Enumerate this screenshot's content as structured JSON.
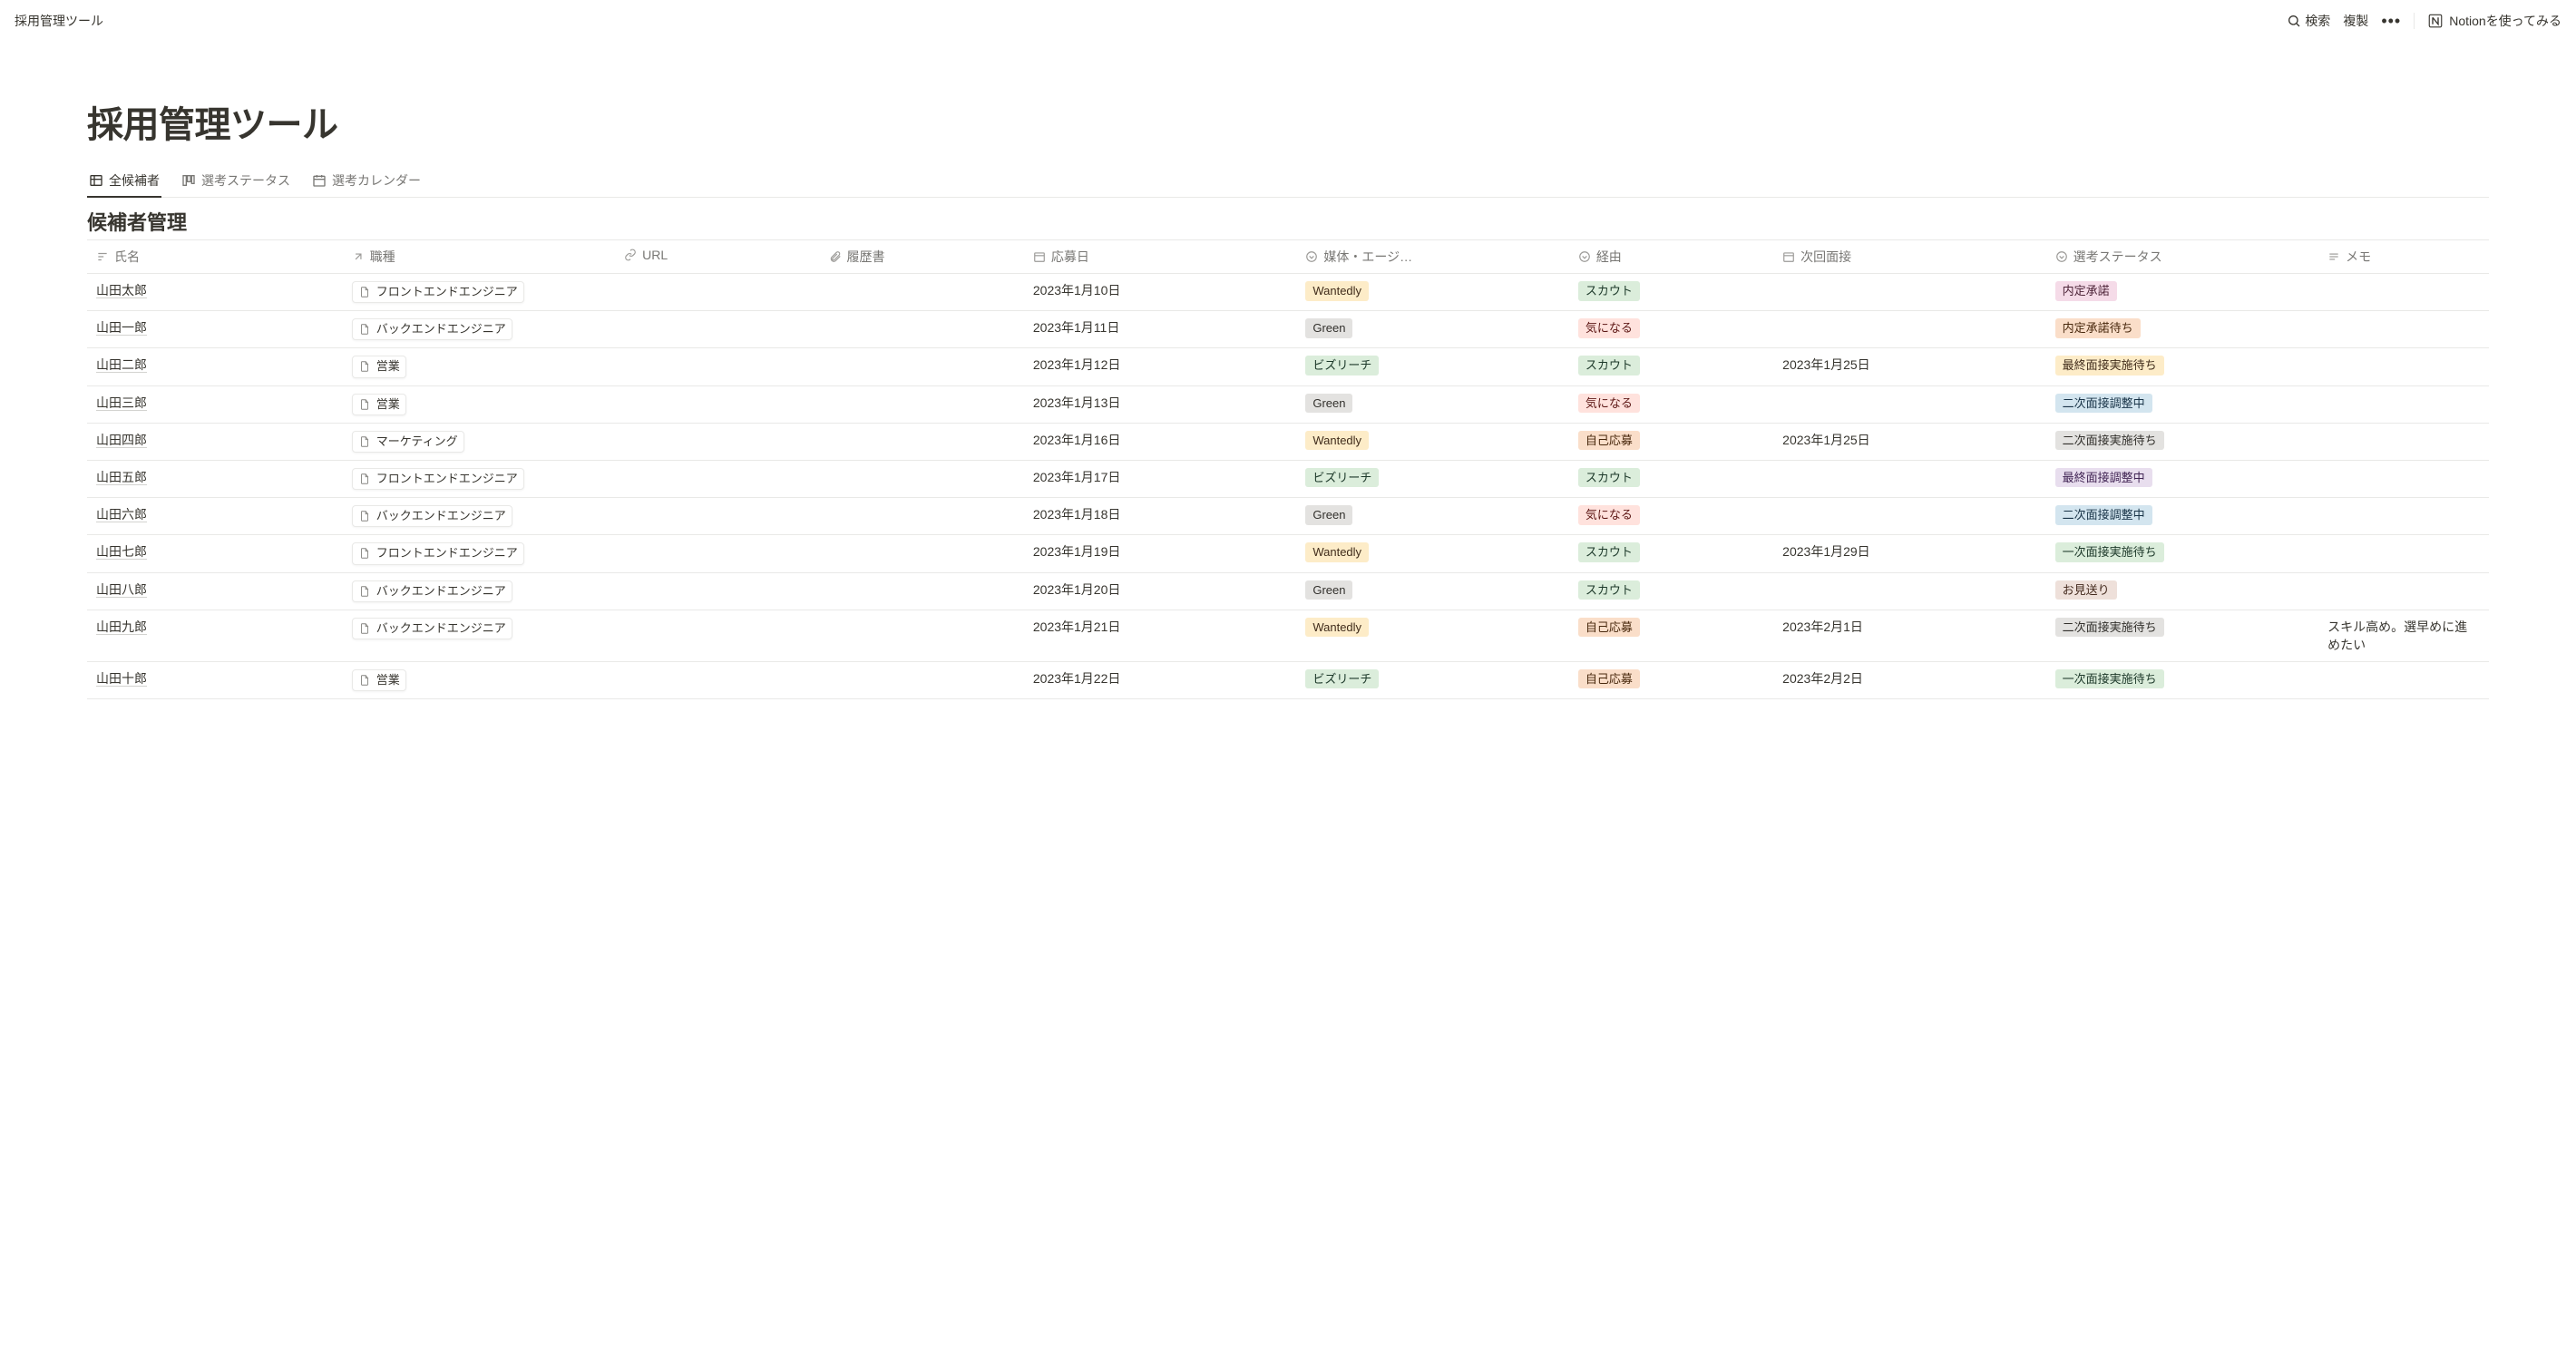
{
  "topbar": {
    "breadcrumb": "採用管理ツール",
    "search": "検索",
    "duplicate": "複製",
    "cta": "Notionを使ってみる"
  },
  "page": {
    "title": "採用管理ツール",
    "section_title": "候補者管理"
  },
  "tabs": [
    {
      "label": "全候補者"
    },
    {
      "label": "選考ステータス"
    },
    {
      "label": "選考カレンダー"
    }
  ],
  "columns": {
    "name": "氏名",
    "role": "職種",
    "url": "URL",
    "resume": "履歴書",
    "apply_date": "応募日",
    "media": "媒体・エージ…",
    "via": "経由",
    "next_interview": "次回面接",
    "status": "選考ステータス",
    "memo": "メモ"
  },
  "tag_colors": {
    "Wantedly": "tag-yellow",
    "Green": "tag-gray",
    "ビズリーチ": "tag-green",
    "スカウト": "tag-green",
    "気になる": "tag-red",
    "自己応募": "tag-orange",
    "内定承諾": "tag-pink",
    "内定承諾待ち": "tag-orange",
    "最終面接実施待ち": "tag-yellow",
    "二次面接調整中": "tag-blue",
    "二次面接実施待ち": "tag-gray",
    "最終面接調整中": "tag-purple",
    "一次面接実施待ち": "tag-green",
    "お見送り": "tag-brown"
  },
  "rows": [
    {
      "name": "山田太郎",
      "role": "フロントエンドエンジニア",
      "url": "",
      "resume": "",
      "apply_date": "2023年1月10日",
      "media": "Wantedly",
      "via": "スカウト",
      "next": "",
      "status": "内定承諾",
      "memo": ""
    },
    {
      "name": "山田一郎",
      "role": "バックエンドエンジニア",
      "url": "",
      "resume": "",
      "apply_date": "2023年1月11日",
      "media": "Green",
      "via": "気になる",
      "next": "",
      "status": "内定承諾待ち",
      "memo": ""
    },
    {
      "name": "山田二郎",
      "role": "営業",
      "url": "",
      "resume": "",
      "apply_date": "2023年1月12日",
      "media": "ビズリーチ",
      "via": "スカウト",
      "next": "2023年1月25日",
      "status": "最終面接実施待ち",
      "memo": ""
    },
    {
      "name": "山田三郎",
      "role": "営業",
      "url": "",
      "resume": "",
      "apply_date": "2023年1月13日",
      "media": "Green",
      "via": "気になる",
      "next": "",
      "status": "二次面接調整中",
      "memo": ""
    },
    {
      "name": "山田四郎",
      "role": "マーケティング",
      "url": "",
      "resume": "",
      "apply_date": "2023年1月16日",
      "media": "Wantedly",
      "via": "自己応募",
      "next": "2023年1月25日",
      "status": "二次面接実施待ち",
      "memo": ""
    },
    {
      "name": "山田五郎",
      "role": "フロントエンドエンジニア",
      "url": "",
      "resume": "",
      "apply_date": "2023年1月17日",
      "media": "ビズリーチ",
      "via": "スカウト",
      "next": "",
      "status": "最終面接調整中",
      "memo": ""
    },
    {
      "name": "山田六郎",
      "role": "バックエンドエンジニア",
      "url": "",
      "resume": "",
      "apply_date": "2023年1月18日",
      "media": "Green",
      "via": "気になる",
      "next": "",
      "status": "二次面接調整中",
      "memo": ""
    },
    {
      "name": "山田七郎",
      "role": "フロントエンドエンジニア",
      "url": "",
      "resume": "",
      "apply_date": "2023年1月19日",
      "media": "Wantedly",
      "via": "スカウト",
      "next": "2023年1月29日",
      "status": "一次面接実施待ち",
      "memo": ""
    },
    {
      "name": "山田八郎",
      "role": "バックエンドエンジニア",
      "url": "",
      "resume": "",
      "apply_date": "2023年1月20日",
      "media": "Green",
      "via": "スカウト",
      "next": "",
      "status": "お見送り",
      "memo": ""
    },
    {
      "name": "山田九郎",
      "role": "バックエンドエンジニア",
      "url": "",
      "resume": "",
      "apply_date": "2023年1月21日",
      "media": "Wantedly",
      "via": "自己応募",
      "next": "2023年2月1日",
      "status": "二次面接実施待ち",
      "memo": "スキル高め。選早めに進めたい"
    },
    {
      "name": "山田十郎",
      "role": "営業",
      "url": "",
      "resume": "",
      "apply_date": "2023年1月22日",
      "media": "ビズリーチ",
      "via": "自己応募",
      "next": "2023年2月2日",
      "status": "一次面接実施待ち",
      "memo": ""
    }
  ]
}
